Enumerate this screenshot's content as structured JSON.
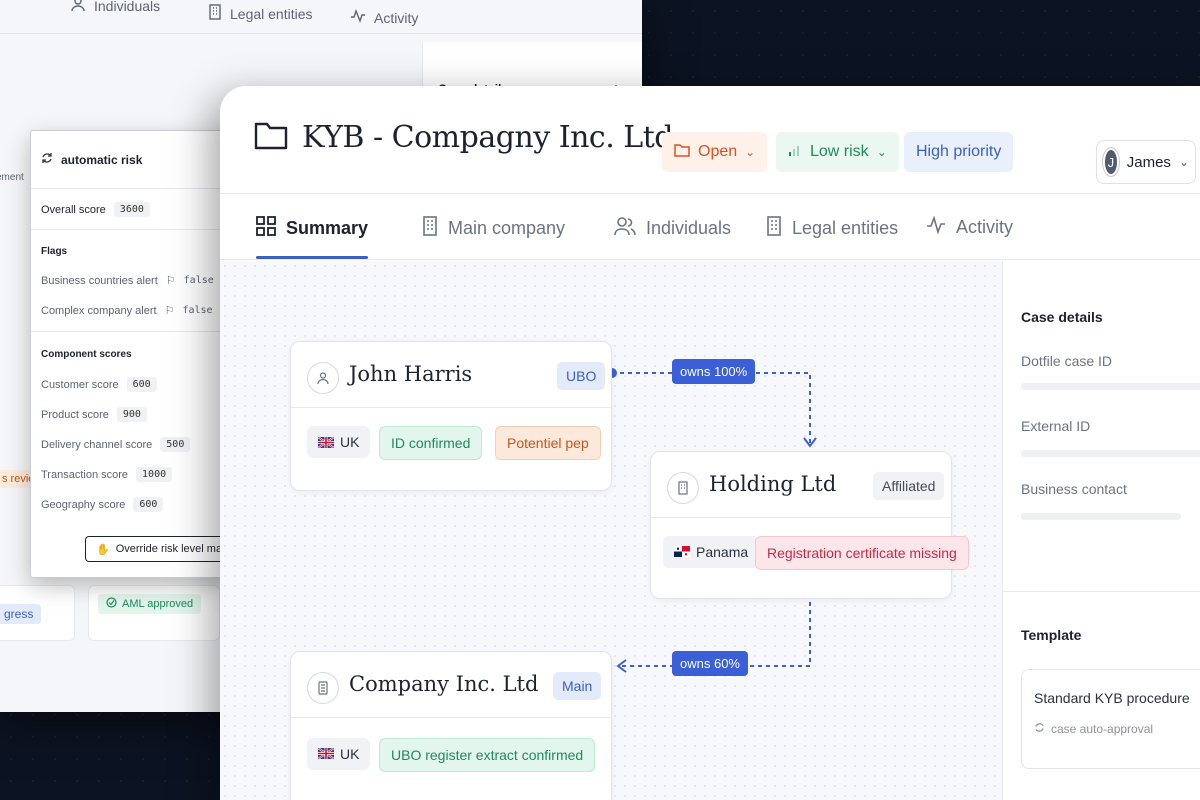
{
  "back_window": {
    "tabs": [
      {
        "label": "Individuals",
        "icon": "user-icon"
      },
      {
        "label": "Legal entities",
        "icon": "building-icon"
      },
      {
        "label": "Activity",
        "icon": "activity-icon"
      }
    ],
    "case_details_title": "Case details",
    "risk_panel": {
      "title": "automatic risk",
      "overall_label": "Overall score",
      "overall_value": "3600",
      "flags_title": "Flags",
      "flags": [
        {
          "label": "Business countries alert",
          "value": "false"
        },
        {
          "label": "Complex company alert",
          "value": "false"
        }
      ],
      "component_title": "Component scores",
      "components": [
        {
          "label": "Customer score",
          "value": "600"
        },
        {
          "label": "Product score",
          "value": "900"
        },
        {
          "label": "Delivery channel score",
          "value": "500"
        },
        {
          "label": "Transaction score",
          "value": "1000"
        },
        {
          "label": "Geography score",
          "value": "600"
        }
      ],
      "override_button": "Override risk level ma"
    },
    "left_fragments": {
      "ement": "ement",
      "review": "s revie",
      "progress": "gress"
    },
    "aml_badge": "AML approved"
  },
  "main_window": {
    "title": "KYB - Compagny Inc. Ltd",
    "status": {
      "open": "Open",
      "risk": "Low risk",
      "priority": "High priority"
    },
    "user": {
      "name": "James",
      "initial": "J"
    },
    "tabs": [
      {
        "label": "Summary",
        "icon": "grid-icon",
        "active": true
      },
      {
        "label": "Main company",
        "icon": "building-icon"
      },
      {
        "label": "Individuals",
        "icon": "users-icon"
      },
      {
        "label": "Legal entities",
        "icon": "building-icon"
      },
      {
        "label": "Activity",
        "icon": "activity-icon"
      }
    ],
    "nodes": {
      "john": {
        "name": "John Harris",
        "tag": "UBO",
        "country": "UK",
        "chips": [
          "ID confirmed",
          "Potentiel pep"
        ]
      },
      "holding": {
        "name": "Holding Ltd",
        "tag": "Affiliated",
        "country": "Panama",
        "chips": [
          "Registration certificate missing"
        ]
      },
      "company": {
        "name": "Company Inc. Ltd",
        "tag": "Main",
        "country": "UK",
        "chips": [
          "UBO register extract confirmed"
        ]
      }
    },
    "edges": [
      {
        "label": "owns 100%"
      },
      {
        "label": "owns 60%"
      }
    ],
    "side": {
      "case_details": "Case details",
      "fields": [
        "Dotfile case ID",
        "External ID",
        "Business contact"
      ],
      "template_title": "Template",
      "template_name": "Standard KYB procedure",
      "template_sub": "case auto-approval"
    }
  },
  "colors": {
    "accent": "#3b5fd6",
    "open": "#d9541e",
    "low_risk": "#1f8b5a",
    "danger": "#c22b47"
  }
}
